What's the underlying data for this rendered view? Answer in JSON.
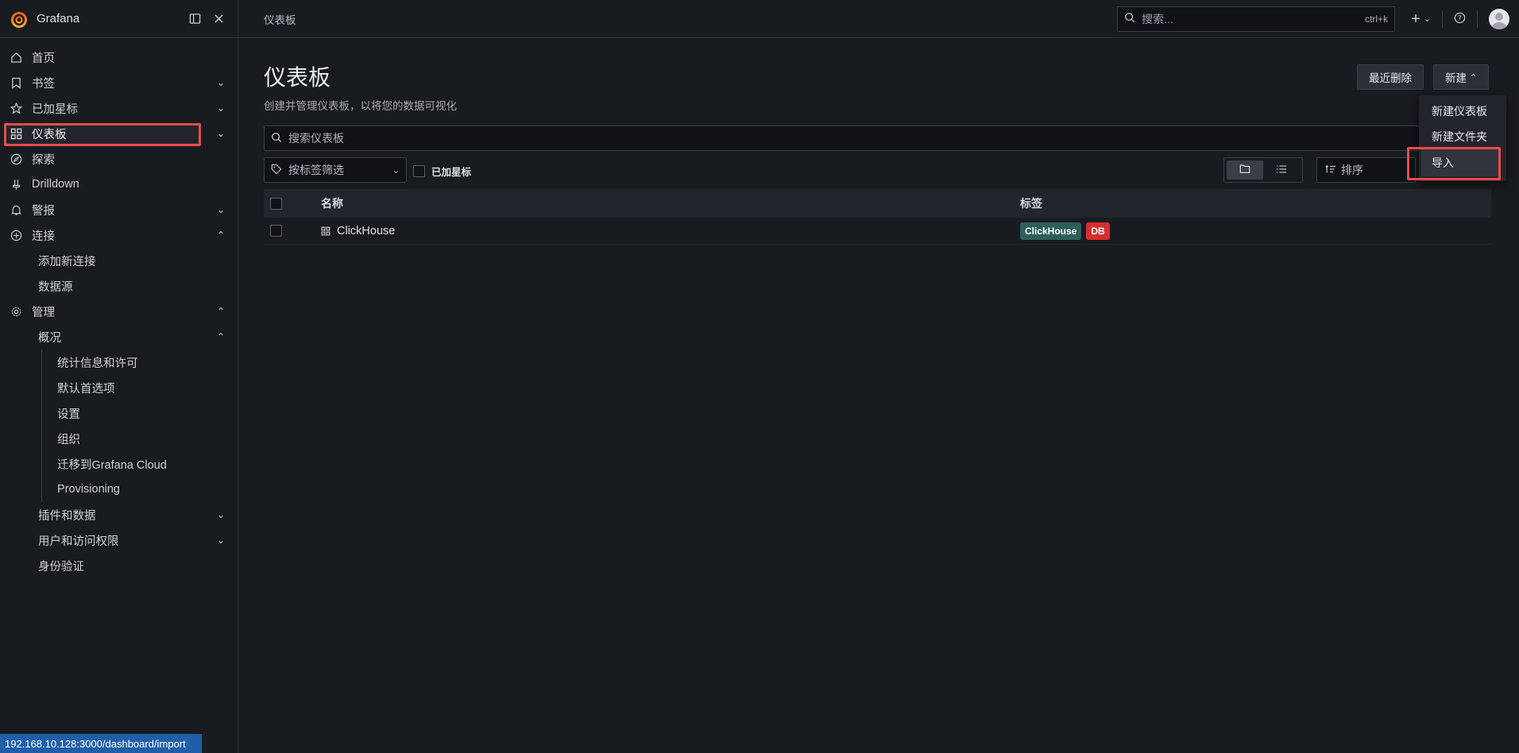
{
  "app": {
    "name": "Grafana"
  },
  "sidebar": {
    "items": [
      {
        "label": "首页",
        "icon": "home-icon"
      },
      {
        "label": "书签",
        "icon": "bookmark-icon"
      },
      {
        "label": "已加星标",
        "icon": "star-icon"
      },
      {
        "label": "仪表板",
        "icon": "dashboards-icon"
      },
      {
        "label": "探索",
        "icon": "compass-icon"
      },
      {
        "label": "Drilldown",
        "icon": "drilldown-icon"
      },
      {
        "label": "警报",
        "icon": "bell-icon"
      },
      {
        "label": "连接",
        "icon": "connections-icon"
      },
      {
        "label": "添加新连接"
      },
      {
        "label": "数据源"
      },
      {
        "label": "管理",
        "icon": "gear-icon"
      },
      {
        "label": "概况"
      },
      {
        "label": "统计信息和许可"
      },
      {
        "label": "默认首选项"
      },
      {
        "label": "设置"
      },
      {
        "label": "组织"
      },
      {
        "label": "迁移到Grafana Cloud"
      },
      {
        "label": "Provisioning"
      },
      {
        "label": "插件和数据"
      },
      {
        "label": "用户和访问权限"
      },
      {
        "label": "身份验证"
      }
    ]
  },
  "topbar": {
    "breadcrumb": "仪表板",
    "search_placeholder": "搜索...",
    "search_shortcut": "ctrl+k"
  },
  "page": {
    "title": "仪表板",
    "subtitle": "创建并管理仪表板，以将您的数据可视化",
    "recently_deleted": "最近删除",
    "new_button": "新建",
    "search_placeholder": "搜索仪表板",
    "tag_filter_placeholder": "按标签筛选",
    "starred_label": "已加星标",
    "sort_placeholder": "排序"
  },
  "table": {
    "headers": {
      "name": "名称",
      "tags": "标签"
    },
    "rows": [
      {
        "name": "ClickHouse",
        "tags": [
          "ClickHouse",
          "DB"
        ]
      }
    ]
  },
  "tag_colors": {
    "ClickHouse": "#2d5f5a",
    "DB": "#d32f2f"
  },
  "new_menu": {
    "items": [
      "新建仪表板",
      "新建文件夹",
      "导入"
    ]
  },
  "status_url": "192.168.10.128:3000/dashboard/import"
}
